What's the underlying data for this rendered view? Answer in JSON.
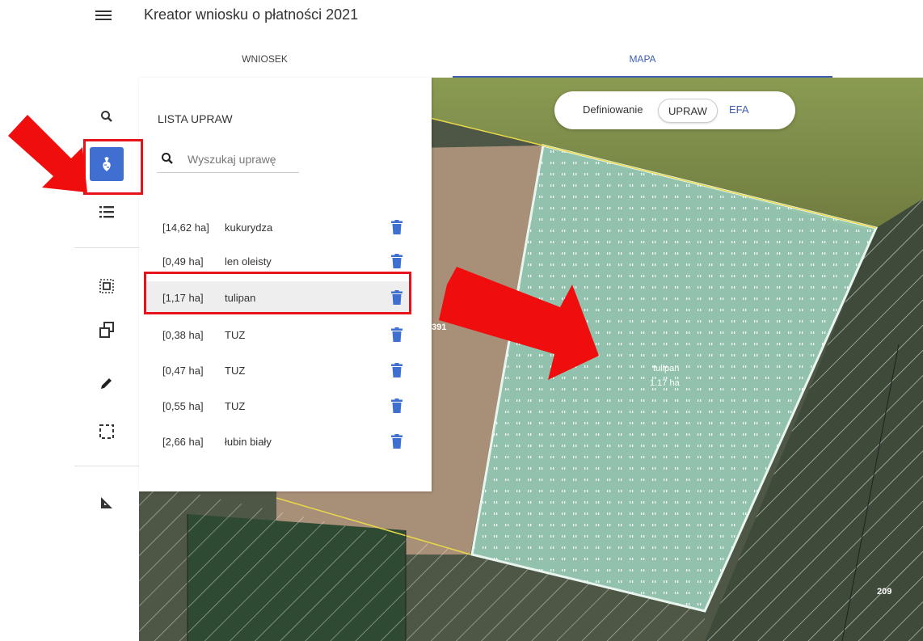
{
  "header": {
    "title": "Kreator wniosku o płatności 2021",
    "tabs": [
      {
        "label": "WNIOSEK",
        "active": false
      },
      {
        "label": "MAPA",
        "active": true
      }
    ]
  },
  "rail": {
    "icons": [
      "search-icon",
      "crop-icon",
      "list-icon",
      "select-parcel-icon",
      "copy-shape-icon",
      "edit-pencil-icon",
      "select-area-icon",
      "measure-icon"
    ],
    "active_icon": "crop-icon",
    "accent_color": "#3f6fd0"
  },
  "crop_list": {
    "title": "LISTA UPRAW",
    "search_placeholder": "Wyszukaj uprawę",
    "items": [
      {
        "area": "[14,62 ha]",
        "name": "kukurydza"
      },
      {
        "area": "[0,49 ha]",
        "name": "len oleisty"
      },
      {
        "area": "[1,17 ha]",
        "name": "tulipan"
      },
      {
        "area": "[0,38 ha]",
        "name": "TUZ"
      },
      {
        "area": "[0,47 ha]",
        "name": "TUZ"
      },
      {
        "area": "[0,55 ha]",
        "name": "TUZ"
      },
      {
        "area": "[2,66 ha]",
        "name": "łubin biały"
      }
    ],
    "selected_index": 2
  },
  "map": {
    "mode_label": "Definiowanie",
    "mode_options": [
      "UPRAW",
      "EFA"
    ],
    "mode_selected": "UPRAW",
    "parcel_label": "tulipan",
    "parcel_area": "1.17 ha",
    "parcel_numbers": [
      "391",
      "209"
    ],
    "parcel_fill_color": "#9fd5bf"
  },
  "annotation_color": "#e8131a"
}
